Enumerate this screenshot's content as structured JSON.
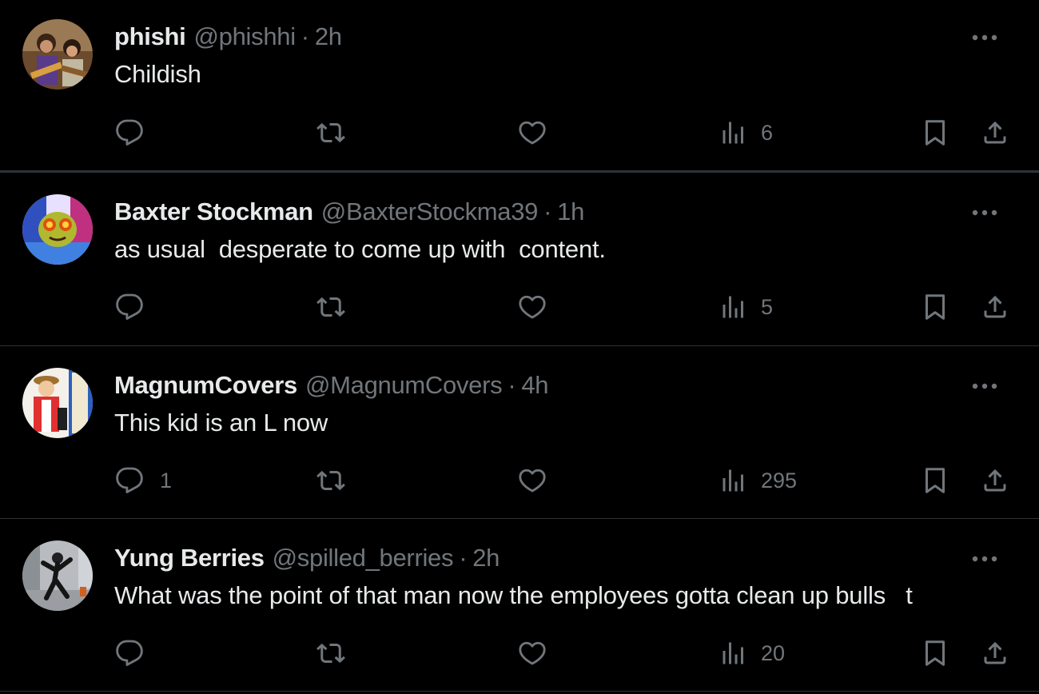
{
  "colors": {
    "background": "#000000",
    "text_primary": "#e7e9ea",
    "text_secondary": "#71767b",
    "divider": "#2f3336"
  },
  "posts": [
    {
      "name": "phishi",
      "handle": "@phishhi",
      "separator": "·",
      "time": "2h",
      "text": "Childish",
      "reply_count": "",
      "views_count": "6",
      "avatar": "avatar-guitarists"
    },
    {
      "name": "Baxter Stockman",
      "handle": "@BaxterStockma39",
      "separator": "·",
      "time": "1h",
      "text": "as usual  desperate to come up with  content.",
      "reply_count": "",
      "views_count": "5",
      "avatar": "avatar-cartoon-fly"
    },
    {
      "name": "MagnumCovers",
      "handle": "@MagnumCovers",
      "separator": "·",
      "time": "4h",
      "text": "This kid is an L now",
      "reply_count": "1",
      "views_count": "295",
      "avatar": "avatar-cartoon-character"
    },
    {
      "name": "Yung Berries",
      "handle": "@spilled_berries",
      "separator": "·",
      "time": "2h",
      "text": "What was the point of that man now the employees gotta clean up bulls   t",
      "reply_count": "",
      "views_count": "20",
      "avatar": "avatar-street-photo"
    }
  ],
  "icons": {
    "reply": "reply-icon",
    "retweet": "retweet-icon",
    "like": "like-icon",
    "views": "views-icon",
    "bookmark": "bookmark-icon",
    "share": "share-icon",
    "more": "more-icon"
  }
}
